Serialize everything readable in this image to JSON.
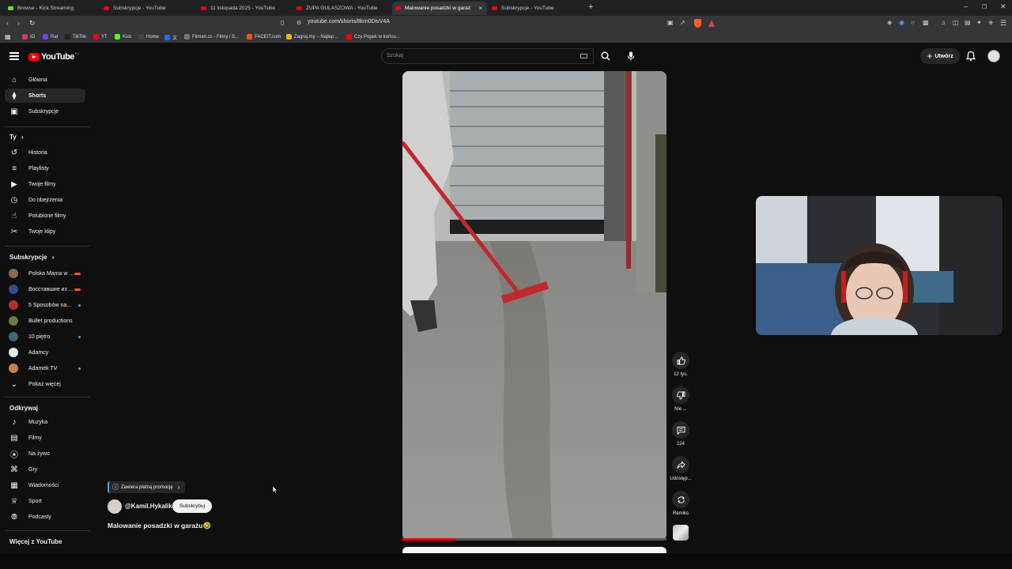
{
  "browser": {
    "tabs": [
      {
        "label": "Browse - Kick Streaming",
        "active": false,
        "fav_color": "#53fc18"
      },
      {
        "label": "Subskrypcje - YouTube",
        "active": false,
        "fav_color": "#ff0000"
      },
      {
        "label": "11 listopada 2025 - YouTube",
        "active": false,
        "fav_color": "#ff0000"
      },
      {
        "label": "ZUPA GULASZOWA - YouTube",
        "active": false,
        "fav_color": "#ff0000"
      },
      {
        "label": "Malowanie posadzki w garaż",
        "active": true,
        "fav_color": "#ff0000"
      },
      {
        "label": "Subskrypcje - YouTube",
        "active": false,
        "fav_color": "#ff0000"
      }
    ],
    "new_tab": "+",
    "url": "youtube.com/shorts/8krn0DivV4A",
    "bookmarks": [
      {
        "label": "IG",
        "color": "#e1306c"
      },
      {
        "label": "Rat",
        "color": "#7a3cff"
      },
      {
        "label": "TikTok",
        "color": "#222222"
      },
      {
        "label": "YT",
        "color": "#ff0000"
      },
      {
        "label": "Kick",
        "color": "#53fc18"
      },
      {
        "label": "Home",
        "color": "#444444"
      },
      {
        "label": "文",
        "color": "#1a73e8"
      },
      {
        "label": "Filman.cc - Filmy i S...",
        "color": "#777777"
      },
      {
        "label": "FACEIT.com",
        "color": "#ff5500"
      },
      {
        "label": "Zagraj.my – Najlep...",
        "color": "#f2b400"
      },
      {
        "label": "Czy Popek w końcu...",
        "color": "#ff0000"
      }
    ]
  },
  "header": {
    "logo_text": "YouTube",
    "country": "PL",
    "search_placeholder": "Szukaj",
    "create_label": "Utwórz"
  },
  "sidebar": {
    "main": [
      {
        "label": "Główna",
        "icon": "home-icon",
        "selected": false
      },
      {
        "label": "Shorts",
        "icon": "shorts-icon",
        "selected": true
      },
      {
        "label": "Subskrypcje",
        "icon": "subscriptions-icon",
        "selected": false
      }
    ],
    "you_header": "Ty",
    "you": [
      {
        "label": "Historia",
        "icon": "history-icon"
      },
      {
        "label": "Playlisty",
        "icon": "playlists-icon"
      },
      {
        "label": "Twoje filmy",
        "icon": "your-videos-icon"
      },
      {
        "label": "Do obejrzenia",
        "icon": "watch-later-icon"
      },
      {
        "label": "Polubione filmy",
        "icon": "liked-videos-icon"
      },
      {
        "label": "Twoje klipy",
        "icon": "clips-icon"
      }
    ],
    "subs_header": "Subskrypcje",
    "subs": [
      {
        "label": "Polska Mama w ...",
        "avatar_color": "#8a6a4a",
        "live": "red"
      },
      {
        "label": "Восставшие из ...",
        "avatar_color": "#3b4a8a",
        "live": "red"
      },
      {
        "label": "5 Sposobów na...",
        "avatar_color": "#b03030",
        "live": "blue"
      },
      {
        "label": "Bullet productions",
        "avatar_color": "#6a7a3a",
        "live": ""
      },
      {
        "label": "10 piętro",
        "avatar_color": "#3a6a6a",
        "live": "blue"
      },
      {
        "label": "Adamcy",
        "avatar_color": "#e8e8e8",
        "live": ""
      },
      {
        "label": "Adamek TV",
        "avatar_color": "#c8804a",
        "live": "blue"
      }
    ],
    "show_more": "Pokaż więcej",
    "explore_header": "Odkrywaj",
    "explore": [
      {
        "label": "Muzyka",
        "icon": "music-icon"
      },
      {
        "label": "Filmy",
        "icon": "movies-icon"
      },
      {
        "label": "Na żywo",
        "icon": "live-icon"
      },
      {
        "label": "Gry",
        "icon": "gaming-icon"
      },
      {
        "label": "Wiadomości",
        "icon": "news-icon"
      },
      {
        "label": "Sport",
        "icon": "sport-icon"
      },
      {
        "label": "Podcasty",
        "icon": "podcasts-icon"
      }
    ],
    "more_header": "Więcej z YouTube"
  },
  "short": {
    "promo_label": "Zawiera płatną promocję",
    "channel": "@Kamil.Hykalik",
    "subscribe_label": "Subskrybuj",
    "title": "Malowanie posadzki w garażu🤣",
    "progress": 0.2,
    "actions": {
      "likes": "12 tys.",
      "dislike": "Nie ...",
      "comments": "224",
      "share": "Udostęp...",
      "remix": "Remiks"
    }
  }
}
